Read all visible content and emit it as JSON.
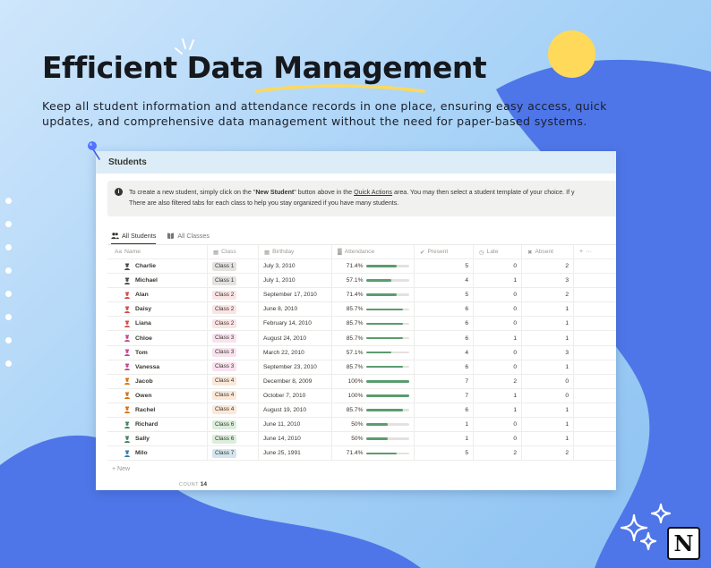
{
  "hero": {
    "headline": "Efficient Data Management",
    "subtitle": "Keep all student information and attendance records in one place, ensuring easy access, quick updates, and comprehensive data management without the need for paper-based systems."
  },
  "colors": {
    "background": "#a9d3f7",
    "blob": "#4f76e8",
    "sun": "#ffd95a",
    "progress": "#5b9c6e"
  },
  "page": {
    "title": "Students",
    "callout": {
      "icon": "info-icon",
      "line1_a": "To create a new student, simply click on the \"",
      "line1_bold": "New Student",
      "line1_b": "\" button above in the ",
      "line1_link": "Quick Actions",
      "line1_c": " area. You may then select a student template of your choice. If y",
      "line2": "There are also filtered tabs for each class to help you stay organized if you have many students."
    },
    "tabs": [
      {
        "label": "All Students",
        "icon": "people-icon",
        "active": true
      },
      {
        "label": "All Classes",
        "icon": "book-icon",
        "active": false
      }
    ]
  },
  "table": {
    "columns": [
      "Name",
      "Class",
      "Birthday",
      "Attendance",
      "Present",
      "Late",
      "Absent"
    ],
    "column_icons": [
      "Aa",
      "class-icon",
      "calendar-icon",
      "chart-icon",
      "check-icon",
      "clock-icon",
      "x-icon"
    ],
    "rows": [
      {
        "name": "Charlie",
        "class": "Class 1",
        "birthday": "July 3, 2010",
        "attendance": "71.4%",
        "attendance_frac": 0.714,
        "present": "5",
        "late": "0",
        "absent": "2"
      },
      {
        "name": "Michael",
        "class": "Class 1",
        "birthday": "July 1, 2010",
        "attendance": "57.1%",
        "attendance_frac": 0.571,
        "present": "4",
        "late": "1",
        "absent": "3"
      },
      {
        "name": "Alan",
        "class": "Class 2",
        "birthday": "September 17, 2010",
        "attendance": "71.4%",
        "attendance_frac": 0.714,
        "present": "5",
        "late": "0",
        "absent": "2"
      },
      {
        "name": "Daisy",
        "class": "Class 2",
        "birthday": "June 8, 2010",
        "attendance": "85.7%",
        "attendance_frac": 0.857,
        "present": "6",
        "late": "0",
        "absent": "1"
      },
      {
        "name": "Liana",
        "class": "Class 2",
        "birthday": "February 14, 2010",
        "attendance": "85.7%",
        "attendance_frac": 0.857,
        "present": "6",
        "late": "0",
        "absent": "1"
      },
      {
        "name": "Chloe",
        "class": "Class 3",
        "birthday": "August 24, 2010",
        "attendance": "85.7%",
        "attendance_frac": 0.857,
        "present": "6",
        "late": "1",
        "absent": "1"
      },
      {
        "name": "Tom",
        "class": "Class 3",
        "birthday": "March 22, 2010",
        "attendance": "57.1%",
        "attendance_frac": 0.571,
        "present": "4",
        "late": "0",
        "absent": "3"
      },
      {
        "name": "Vanessa",
        "class": "Class 3",
        "birthday": "September 23, 2010",
        "attendance": "85.7%",
        "attendance_frac": 0.857,
        "present": "6",
        "late": "0",
        "absent": "1"
      },
      {
        "name": "Jacob",
        "class": "Class 4",
        "birthday": "December 8, 2009",
        "attendance": "100%",
        "attendance_frac": 1.0,
        "present": "7",
        "late": "2",
        "absent": "0"
      },
      {
        "name": "Owen",
        "class": "Class 4",
        "birthday": "October 7, 2010",
        "attendance": "100%",
        "attendance_frac": 1.0,
        "present": "7",
        "late": "1",
        "absent": "0"
      },
      {
        "name": "Rachel",
        "class": "Class 4",
        "birthday": "August 19, 2010",
        "attendance": "85.7%",
        "attendance_frac": 0.857,
        "present": "6",
        "late": "1",
        "absent": "1"
      },
      {
        "name": "Richard",
        "class": "Class 6",
        "birthday": "June 11, 2010",
        "attendance": "50%",
        "attendance_frac": 0.5,
        "present": "1",
        "late": "0",
        "absent": "1"
      },
      {
        "name": "Sally",
        "class": "Class 6",
        "birthday": "June 14, 2010",
        "attendance": "50%",
        "attendance_frac": 0.5,
        "present": "1",
        "late": "0",
        "absent": "1"
      },
      {
        "name": "Milo",
        "class": "Class 7",
        "birthday": "June 25, 1991",
        "attendance": "71.4%",
        "attendance_frac": 0.714,
        "present": "5",
        "late": "2",
        "absent": "2"
      }
    ],
    "class_colors": {
      "Class 1": {
        "bg": "#e3e2e0",
        "icon": "#4a4a48"
      },
      "Class 2": {
        "bg": "#fbe4e4",
        "icon": "#d44c47"
      },
      "Class 3": {
        "bg": "#f9e2ef",
        "icon": "#c14c8a"
      },
      "Class 4": {
        "bg": "#fbe8d8",
        "icon": "#d9730d"
      },
      "Class 6": {
        "bg": "#dbeddb",
        "icon": "#448361"
      },
      "Class 7": {
        "bg": "#d3e5ef",
        "icon": "#337ea9"
      }
    },
    "new_label": "+ New",
    "count_label": "COUNT",
    "count_value": "14",
    "add_column": "+",
    "more": "···"
  },
  "brand": {
    "logo_letter": "N"
  }
}
